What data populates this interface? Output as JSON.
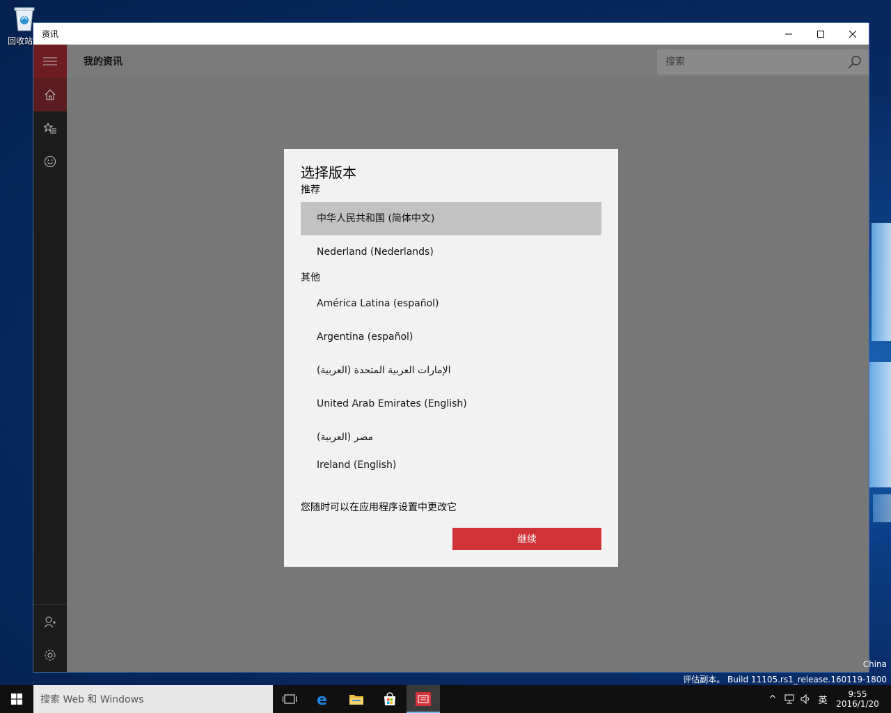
{
  "desktop": {
    "recycle_bin_label": "回收站",
    "watermark_line1": "China",
    "watermark_line2": "评估副本。 Build 11105.rs1_release.160119-1800"
  },
  "window": {
    "title": "资讯",
    "controls": [
      "minimize",
      "maximize",
      "close"
    ]
  },
  "app": {
    "page_title": "我的资讯",
    "search_placeholder": "搜索",
    "sidebar_icons": [
      "hamburger-icon",
      "home-icon",
      "favorites-icon",
      "emoji-icon",
      "account-icon",
      "settings-icon"
    ]
  },
  "dialog": {
    "title": "选择版本",
    "recommended_label": "推荐",
    "recommended": [
      {
        "label": "中华人民共和国 (简体中文)",
        "selected": true
      },
      {
        "label": "Nederland (Nederlands)",
        "selected": false
      }
    ],
    "other_label": "其他",
    "other": [
      {
        "label": "América Latina (español)"
      },
      {
        "label": "Argentina (español)"
      },
      {
        "label": "(العربية) الإمارات العربية المتحدة"
      },
      {
        "label": "United Arab Emirates (English)"
      },
      {
        "label": "(العربية) مصر"
      },
      {
        "label": "Ireland (English)"
      }
    ],
    "hint": "您随时可以在应用程序设置中更改它",
    "continue_label": "继续"
  },
  "taskbar": {
    "search_placeholder": "搜索 Web 和 Windows",
    "ime": "英",
    "time": "9:55",
    "date": "2016/1/20"
  },
  "colors": {
    "accent": "#d13438",
    "sidebar": "#1c1c1c",
    "selected_item": "#c2c2c2"
  }
}
